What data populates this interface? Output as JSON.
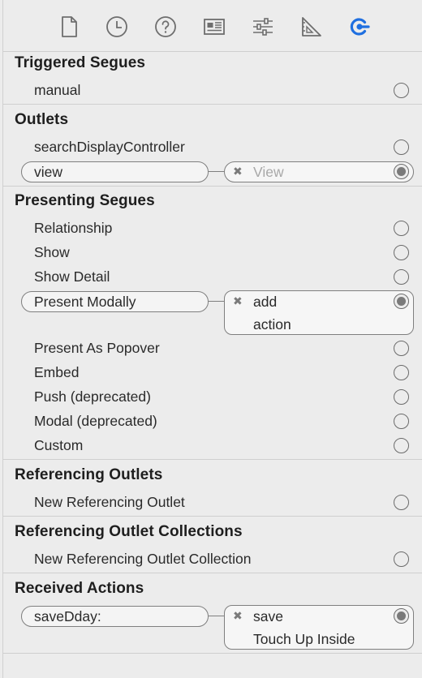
{
  "toolbar": {
    "icons": [
      "file-inspector-icon",
      "history-inspector-icon",
      "quick-help-icon",
      "identity-inspector-icon",
      "attributes-inspector-icon",
      "size-inspector-icon",
      "connections-inspector-icon"
    ],
    "active_color": "#1f6fe0",
    "icon_color": "#6e6e6e"
  },
  "triggered_segues": {
    "title": "Triggered Segues",
    "items": [
      "manual"
    ]
  },
  "outlets": {
    "title": "Outlets",
    "items": [
      "searchDisplayController"
    ],
    "connected": {
      "name": "view",
      "target": "View"
    }
  },
  "presenting_segues": {
    "title": "Presenting Segues",
    "items_before": [
      "Relationship",
      "Show",
      "Show Detail"
    ],
    "connected": {
      "name": "Present Modally",
      "target_line1": "add",
      "target_line2": "action"
    },
    "items_after": [
      "Present As Popover",
      "Embed",
      "Push (deprecated)",
      "Modal (deprecated)",
      "Custom"
    ]
  },
  "referencing_outlets": {
    "title": "Referencing Outlets",
    "items": [
      "New Referencing Outlet"
    ]
  },
  "referencing_outlet_collections": {
    "title": "Referencing Outlet Collections",
    "items": [
      "New Referencing Outlet Collection"
    ]
  },
  "received_actions": {
    "title": "Received Actions",
    "connected": {
      "name": "saveDday:",
      "target_line1": "save",
      "target_line2": "Touch Up Inside"
    }
  },
  "disconnect_glyph": "✖"
}
